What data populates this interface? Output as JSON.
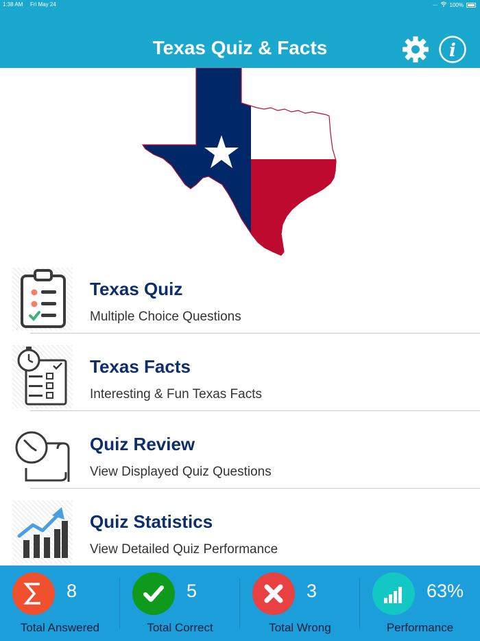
{
  "status_bar": {
    "time": "1:38 AM",
    "date": "Fri May 24",
    "battery": "100%"
  },
  "header": {
    "title": "Texas Quiz & Facts",
    "settings_icon": "gear-icon",
    "info_icon": "info-icon"
  },
  "colors": {
    "header_bg": "#1ba8cf",
    "stats_bg": "#1c9edb",
    "flag_blue": "#002868",
    "flag_red": "#bf0a30",
    "title_navy": "#0d2d6c",
    "answered": "#f0502d",
    "correct": "#109a1c",
    "wrong": "#e94141",
    "performance": "#13c7c4"
  },
  "menu": {
    "items": [
      {
        "label": "Texas Quiz",
        "sub": "Multiple Choice Questions",
        "icon": "clipboard-checklist-icon"
      },
      {
        "label": "Texas Facts",
        "sub": "Interesting & Fun Texas Facts",
        "icon": "stopwatch-checklist-icon"
      },
      {
        "label": "Quiz Review",
        "sub": "View Displayed Quiz Questions",
        "icon": "clock-scroll-icon"
      },
      {
        "label": "Quiz Statistics",
        "sub": "View Detailed Quiz Performance",
        "icon": "growth-chart-icon"
      }
    ]
  },
  "stats": {
    "items": [
      {
        "value": "8",
        "caption": "Total Answered",
        "icon": "sigma-icon"
      },
      {
        "value": "5",
        "caption": "Total Correct",
        "icon": "checkmark-icon"
      },
      {
        "value": "3",
        "caption": "Total Wrong",
        "icon": "x-icon"
      },
      {
        "value": "63%",
        "caption": "Performance",
        "icon": "bar-chart-icon"
      }
    ]
  }
}
